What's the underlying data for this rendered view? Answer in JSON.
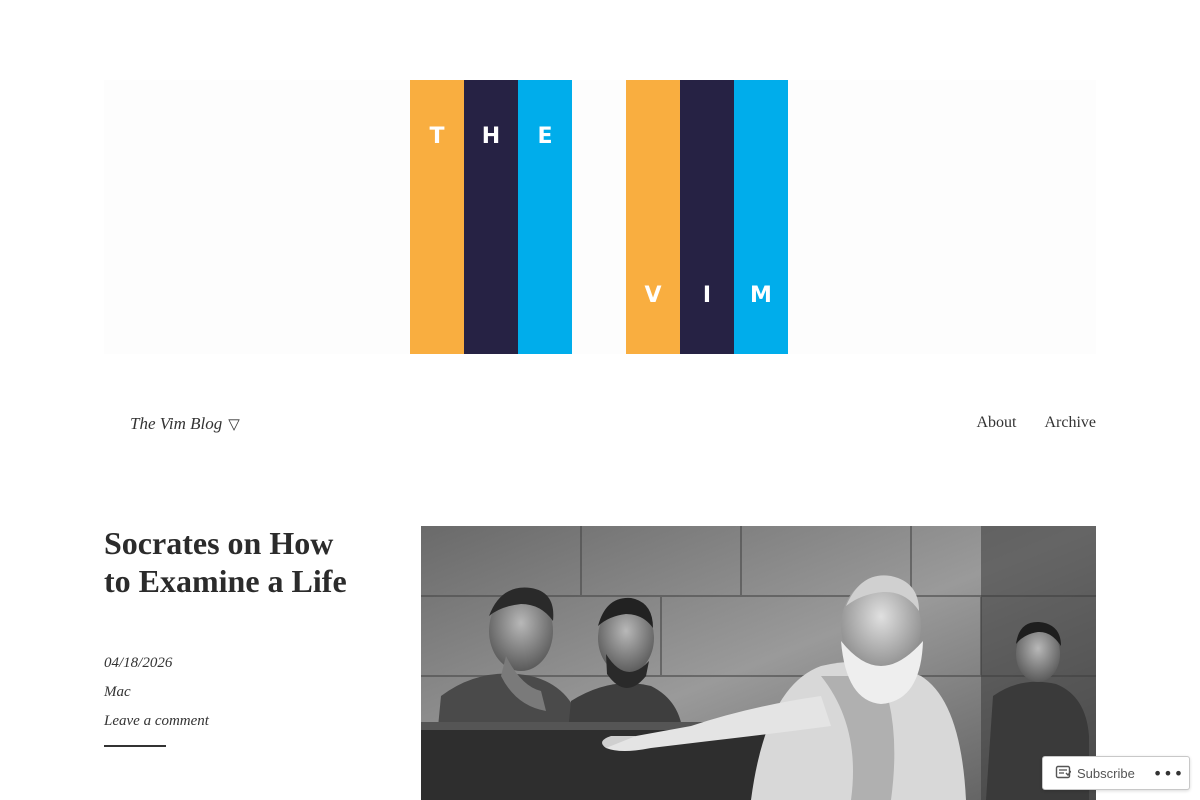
{
  "header": {
    "logo_letters_top": [
      "T",
      "H",
      "E"
    ],
    "logo_letters_bottom": [
      "V",
      "I",
      "M"
    ],
    "colors": {
      "orange": "#f9ae40",
      "navy": "#262244",
      "blue": "#00adeb"
    }
  },
  "nav": {
    "site_title": "The Vim Blog",
    "site_title_icon": "▽",
    "items": [
      {
        "label": "About"
      },
      {
        "label": "Archive"
      }
    ]
  },
  "post": {
    "title": "Socrates on How to Examine a Life",
    "date": "04/18/2026",
    "author": "Mac",
    "comment_link": "Leave a comment",
    "featured_image": "grayscale-engraving-socrates-teaching"
  },
  "subscribe_bar": {
    "subscribe_label": "Subscribe",
    "subscribe_icon": "reader-icon",
    "more_icon": "•••"
  }
}
